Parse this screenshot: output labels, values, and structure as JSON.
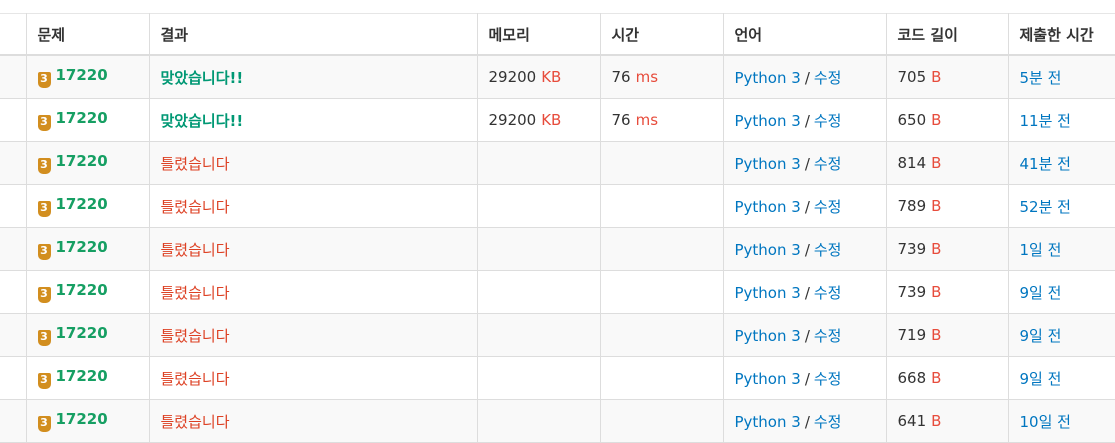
{
  "headers": {
    "problem": "문제",
    "result": "결과",
    "memory": "메모리",
    "time": "시간",
    "language": "언어",
    "code_length": "코드 길이",
    "submitted": "제출한 시간"
  },
  "colors": {
    "accepted": "#009874",
    "wrong": "#dd4124",
    "link": "#0076c0",
    "unit": "#e74c3c",
    "tier_bronze": "#d28e1f"
  },
  "icons": {
    "tier": "bronze-tier-badge-icon"
  },
  "rows": [
    {
      "tier": "3",
      "problem": "17220",
      "result": "맞았습니다!!",
      "status": "ac",
      "memory": "29200",
      "memory_unit": "KB",
      "time": "76",
      "time_unit": "ms",
      "lang": "Python 3",
      "sep": "/",
      "edit": "수정",
      "length": "705",
      "length_unit": "B",
      "when": "5분 전"
    },
    {
      "tier": "3",
      "problem": "17220",
      "result": "맞았습니다!!",
      "status": "ac",
      "memory": "29200",
      "memory_unit": "KB",
      "time": "76",
      "time_unit": "ms",
      "lang": "Python 3",
      "sep": "/",
      "edit": "수정",
      "length": "650",
      "length_unit": "B",
      "when": "11분 전"
    },
    {
      "tier": "3",
      "problem": "17220",
      "result": "틀렸습니다",
      "status": "wa",
      "memory": "",
      "memory_unit": "",
      "time": "",
      "time_unit": "",
      "lang": "Python 3",
      "sep": "/",
      "edit": "수정",
      "length": "814",
      "length_unit": "B",
      "when": "41분 전"
    },
    {
      "tier": "3",
      "problem": "17220",
      "result": "틀렸습니다",
      "status": "wa",
      "memory": "",
      "memory_unit": "",
      "time": "",
      "time_unit": "",
      "lang": "Python 3",
      "sep": "/",
      "edit": "수정",
      "length": "789",
      "length_unit": "B",
      "when": "52분 전"
    },
    {
      "tier": "3",
      "problem": "17220",
      "result": "틀렸습니다",
      "status": "wa",
      "memory": "",
      "memory_unit": "",
      "time": "",
      "time_unit": "",
      "lang": "Python 3",
      "sep": "/",
      "edit": "수정",
      "length": "739",
      "length_unit": "B",
      "when": "1일 전"
    },
    {
      "tier": "3",
      "problem": "17220",
      "result": "틀렸습니다",
      "status": "wa",
      "memory": "",
      "memory_unit": "",
      "time": "",
      "time_unit": "",
      "lang": "Python 3",
      "sep": "/",
      "edit": "수정",
      "length": "739",
      "length_unit": "B",
      "when": "9일 전"
    },
    {
      "tier": "3",
      "problem": "17220",
      "result": "틀렸습니다",
      "status": "wa",
      "memory": "",
      "memory_unit": "",
      "time": "",
      "time_unit": "",
      "lang": "Python 3",
      "sep": "/",
      "edit": "수정",
      "length": "719",
      "length_unit": "B",
      "when": "9일 전"
    },
    {
      "tier": "3",
      "problem": "17220",
      "result": "틀렸습니다",
      "status": "wa",
      "memory": "",
      "memory_unit": "",
      "time": "",
      "time_unit": "",
      "lang": "Python 3",
      "sep": "/",
      "edit": "수정",
      "length": "668",
      "length_unit": "B",
      "when": "9일 전"
    },
    {
      "tier": "3",
      "problem": "17220",
      "result": "틀렸습니다",
      "status": "wa",
      "memory": "",
      "memory_unit": "",
      "time": "",
      "time_unit": "",
      "lang": "Python 3",
      "sep": "/",
      "edit": "수정",
      "length": "641",
      "length_unit": "B",
      "when": "10일 전"
    }
  ]
}
